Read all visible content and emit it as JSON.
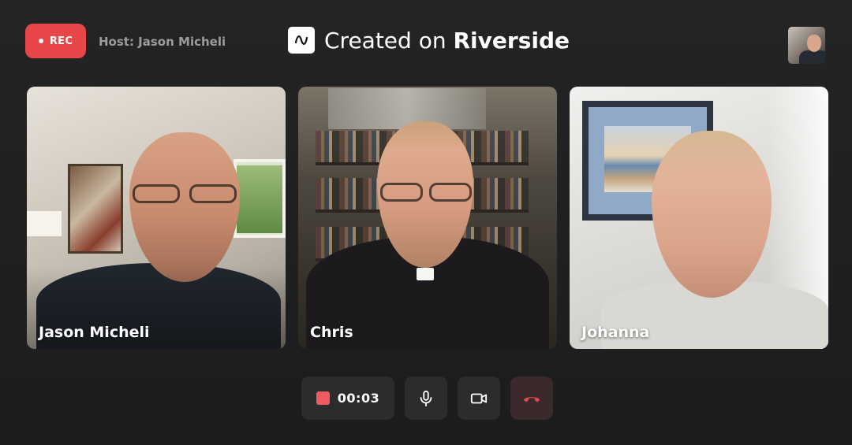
{
  "header": {
    "rec_label": "REC",
    "host_text": "Host: Jason Micheli",
    "brand_prefix": "Created on ",
    "brand_name": "Riverside"
  },
  "participants": [
    {
      "name": "Jason Micheli"
    },
    {
      "name": "Chris"
    },
    {
      "name": "Johanna"
    }
  ],
  "controls": {
    "timer": "00:03",
    "icons": [
      "stop-square-icon",
      "microphone-icon",
      "video-camera-icon",
      "end-call-icon"
    ]
  },
  "colors": {
    "rec": "#e8474a",
    "background": "#1e1e1e",
    "control_bg": "#2c2c2c",
    "end_call_bg": "#3a2a2b",
    "end_call_icon": "#e5484d"
  }
}
